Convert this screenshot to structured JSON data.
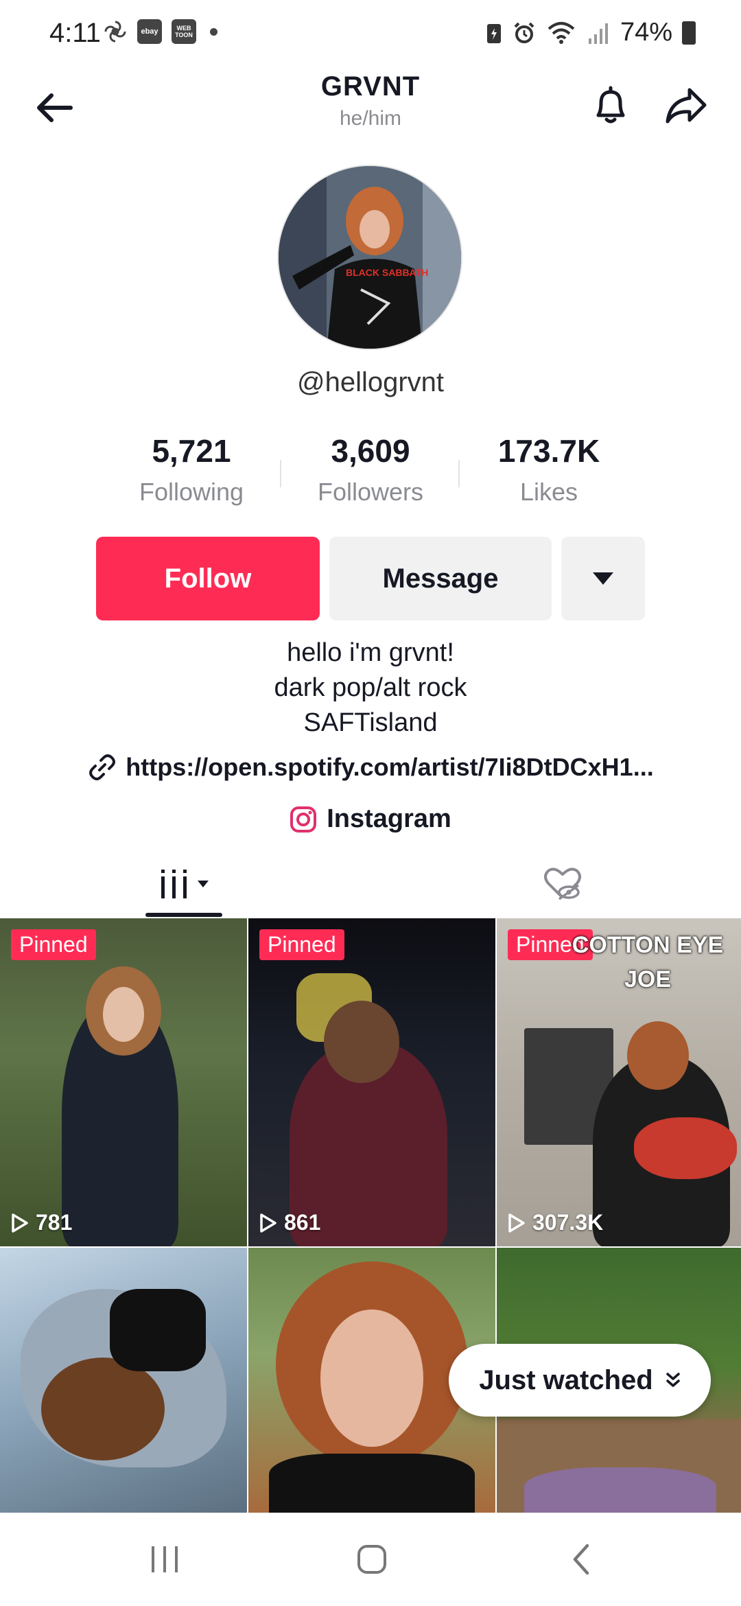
{
  "status_bar": {
    "time": "4:11",
    "app_icons": [
      "pinwheel-icon",
      "ebay-icon",
      "webtoon-icon"
    ],
    "ebay_label": "ebay",
    "webtoon_label": "WEB TOON",
    "battery_percent": "74%"
  },
  "header": {
    "title": "GRVNT",
    "pronouns": "he/him"
  },
  "profile": {
    "username": "@hellogrvnt",
    "stats": [
      {
        "value": "5,721",
        "label": "Following"
      },
      {
        "value": "3,609",
        "label": "Followers"
      },
      {
        "value": "173.7K",
        "label": "Likes"
      }
    ],
    "follow_label": "Follow",
    "message_label": "Message",
    "bio_lines": [
      "hello i'm grvnt!",
      "dark pop/alt rock",
      "SAFTisland"
    ],
    "link": "https://open.spotify.com/artist/7Ii8DtDCxH1...",
    "instagram_label": "Instagram"
  },
  "grid": {
    "tiles": [
      {
        "pinned": "Pinned",
        "views": "781"
      },
      {
        "pinned": "Pinned",
        "views": "861"
      },
      {
        "pinned": "Pinned",
        "views": "307.3K",
        "overlay": "COTTON EYE JOE"
      }
    ]
  },
  "just_watched_label": "Just watched",
  "colors": {
    "accent": "#fe2c55",
    "button_gray": "#f1f1f2",
    "text_primary": "#161823",
    "text_secondary": "#8a8b91"
  }
}
